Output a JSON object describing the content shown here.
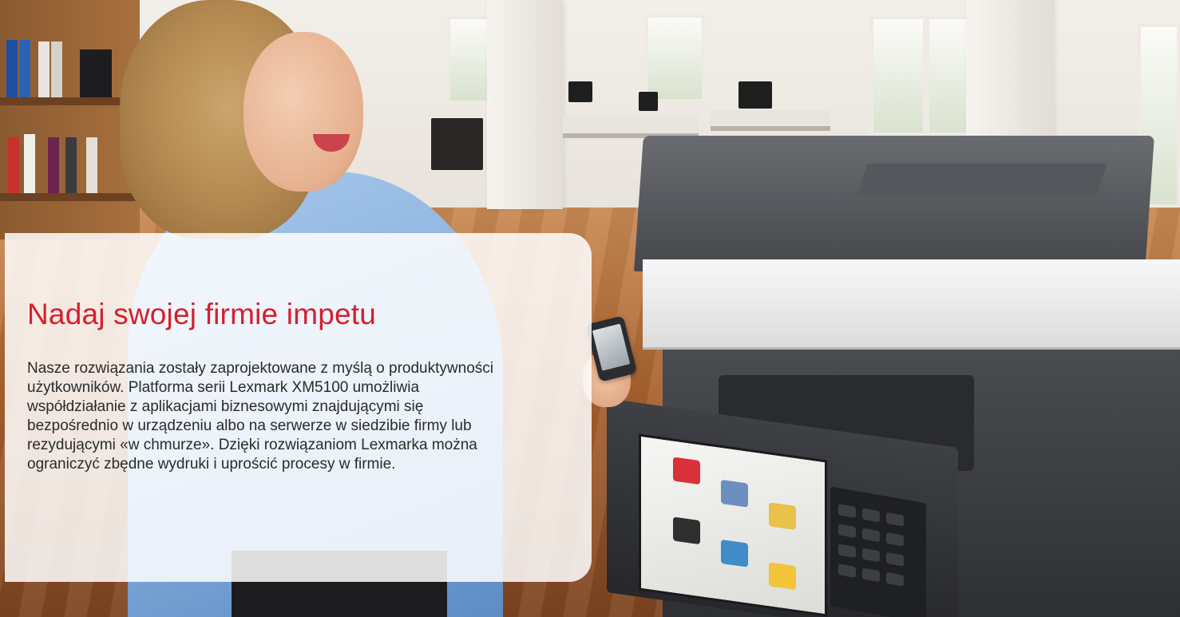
{
  "hero": {
    "headline": "Nadaj swojej firmie impetu",
    "body": "Nasze rozwiązania zostały zaprojektowane z myślą o produktywności użytkowników. Platforma serii Lexmark XM5100 umożliwia współdziałanie z aplikacjami biznesowymi znajdującymi się bezpośrednio w urządzeniu albo na serwerze w siedzibie firmy lub rezydującymi «w chmurze». Dzięki rozwiązaniom Lexmarka można ograniczyć zbędne wydruki i uprościć procesy w firmie."
  },
  "colors": {
    "headline": "#d4202e",
    "body_text": "#2a2a2a",
    "card_background": "#ffffff"
  }
}
